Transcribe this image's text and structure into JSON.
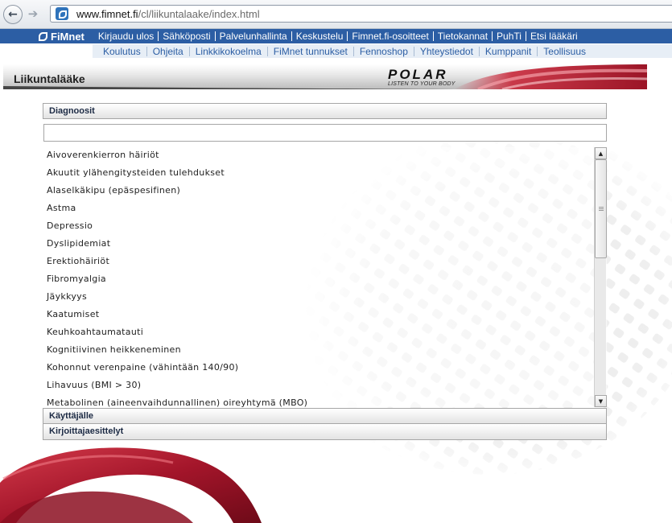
{
  "browser": {
    "url_host": "www.fimnet.fi",
    "url_path": "/cl/liikuntalaake/index.html",
    "back_icon": "arrow-left-icon",
    "forward_icon": "arrow-right-icon"
  },
  "topnav": {
    "logo": "FiMnet",
    "items": [
      "Kirjaudu ulos",
      "Sähköposti",
      "Palvelunhallinta",
      "Keskustelu",
      "Fimnet.fi-osoitteet",
      "Tietokannat",
      "PuhTi",
      "Etsi lääkäri"
    ]
  },
  "subnav": {
    "items": [
      "Koulutus",
      "Ohjeita",
      "Linkkikokoelma",
      "FiMnet tunnukset",
      "Fennoshop",
      "Yhteystiedot",
      "Kumppanit",
      "Teollisuus"
    ]
  },
  "app": {
    "title": "Liikuntalääke",
    "brand": "POLAR",
    "brand_tagline": "LISTEN TO YOUR BODY"
  },
  "accordion": {
    "section1": "Diagnoosit",
    "section2": "Käyttäjälle",
    "section3": "Kirjoittajaesittelyt",
    "filter_value": "",
    "diagnoses": [
      "Aivoverenkierron häiriöt",
      "Akuutit ylähengitysteiden tulehdukset",
      "Alaselkäkipu (epäspesifinen)",
      "Astma",
      "Depressio",
      "Dyslipidemiat",
      "Erektiohäiriöt",
      "Fibromyalgia",
      "Jäykkyys",
      "Kaatumiset",
      "Keuhkoahtaumatauti",
      "Kognitiivinen heikkeneminen",
      "Kohonnut verenpaine (vähintään 140/90)",
      "Lihavuus (BMI > 30)",
      "Metabolinen (aineenvaihdunnallinen) oireyhtymä (MBO)"
    ]
  },
  "colors": {
    "nav_blue": "#2c5ea4",
    "brand_red": "#b01e2d"
  }
}
